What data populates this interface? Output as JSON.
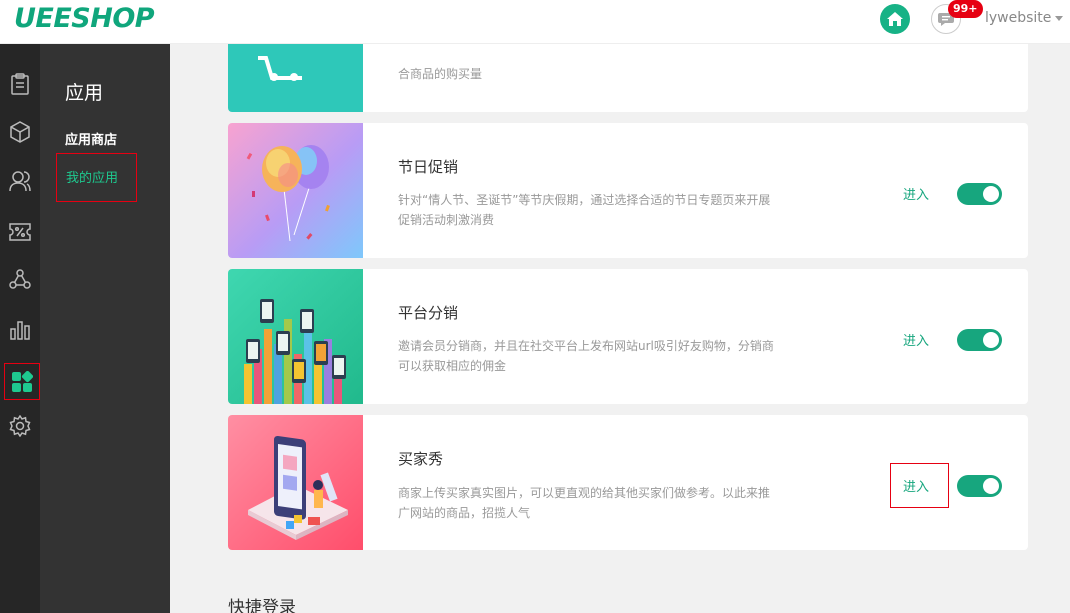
{
  "header": {
    "logo": "UEESHOP",
    "badge": "99+",
    "username": "lywebsite"
  },
  "rail": [
    "clipboard-icon",
    "box-icon",
    "users-icon",
    "discount-icon",
    "share-icon",
    "chart-icon",
    "apps-icon",
    "gear-icon"
  ],
  "subsidebar": {
    "title": "应用",
    "links": [
      "应用商店",
      "我的应用"
    ]
  },
  "cards": [
    {
      "title": "",
      "desc": "合商品的购买量",
      "thumb_color": "#2ec8b9"
    },
    {
      "title": "节日促销",
      "desc": "针对“情人节、圣诞节”等节庆假期，通过选择合适的节日专题页来开展促销活动刺激消费",
      "enter": "进入",
      "enabled": true
    },
    {
      "title": "平台分销",
      "desc": "邀请会员分销商，并且在社交平台上发布网站url吸引好友购物，分销商可以获取相应的佣金",
      "enter": "进入",
      "enabled": true
    },
    {
      "title": "买家秀",
      "desc": "商家上传买家真实图片，可以更直观的给其他买家们做参考。以此来推广网站的商品，招揽人气",
      "enter": "进入",
      "enabled": true
    }
  ],
  "section": {
    "title": "快捷登录"
  },
  "colors": {
    "brand": "#17a67e",
    "highlight": "#e60012",
    "rail_bg": "#262626",
    "subside_bg": "#333333"
  }
}
